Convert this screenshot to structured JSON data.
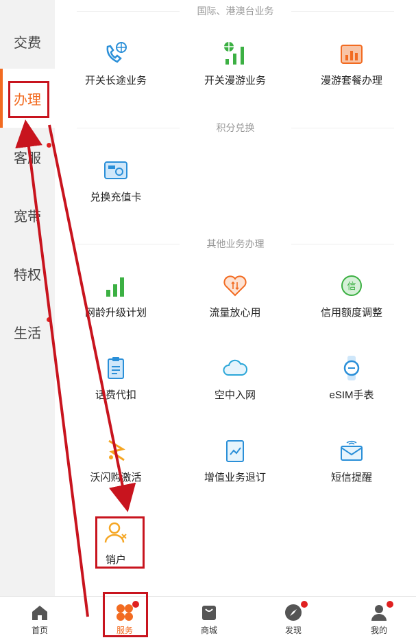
{
  "sidebar": {
    "items": [
      {
        "label": "交费"
      },
      {
        "label": "办理"
      },
      {
        "label": "客服"
      },
      {
        "label": "宽带"
      },
      {
        "label": "特权"
      },
      {
        "label": "生活"
      }
    ]
  },
  "sections": [
    {
      "title": "国际、港澳台业务",
      "items": [
        {
          "label": "开关长途业务",
          "icon": "phone-globe-icon"
        },
        {
          "label": "开关漫游业务",
          "icon": "signal-globe-icon"
        },
        {
          "label": "漫游套餐办理",
          "icon": "package-chart-icon"
        }
      ]
    },
    {
      "title": "积分兑换",
      "items": [
        {
          "label": "兑换充值卡",
          "icon": "recharge-card-icon"
        }
      ]
    },
    {
      "title": "其他业务办理",
      "items": [
        {
          "label": "网龄升级计划",
          "icon": "signal-bars-icon"
        },
        {
          "label": "流量放心用",
          "icon": "heart-data-icon"
        },
        {
          "label": "信用额度调整",
          "icon": "credit-refresh-icon"
        },
        {
          "label": "话费代扣",
          "icon": "clipboard-icon"
        },
        {
          "label": "空中入网",
          "icon": "cloud-icon"
        },
        {
          "label": "eSIM手表",
          "icon": "watch-icon"
        },
        {
          "label": "沃闪购激活",
          "icon": "flash-buy-icon"
        },
        {
          "label": "增值业务退订",
          "icon": "unsubscribe-icon"
        },
        {
          "label": "短信提醒",
          "icon": "sms-envelope-icon"
        },
        {
          "label": "销户",
          "icon": "user-cancel-icon"
        }
      ]
    }
  ],
  "tabbar": {
    "items": [
      {
        "label": "首页",
        "icon": "home-icon"
      },
      {
        "label": "服务",
        "icon": "service-grid-icon"
      },
      {
        "label": "商城",
        "icon": "shopping-bag-icon"
      },
      {
        "label": "发现",
        "icon": "compass-icon"
      },
      {
        "label": "我的",
        "icon": "user-icon"
      }
    ]
  },
  "colors": {
    "accent": "#f26b21",
    "annotation": "#c8141e",
    "icon_blue": "#2a8fd8",
    "icon_green": "#3cb043",
    "icon_orange": "#f26b21"
  }
}
